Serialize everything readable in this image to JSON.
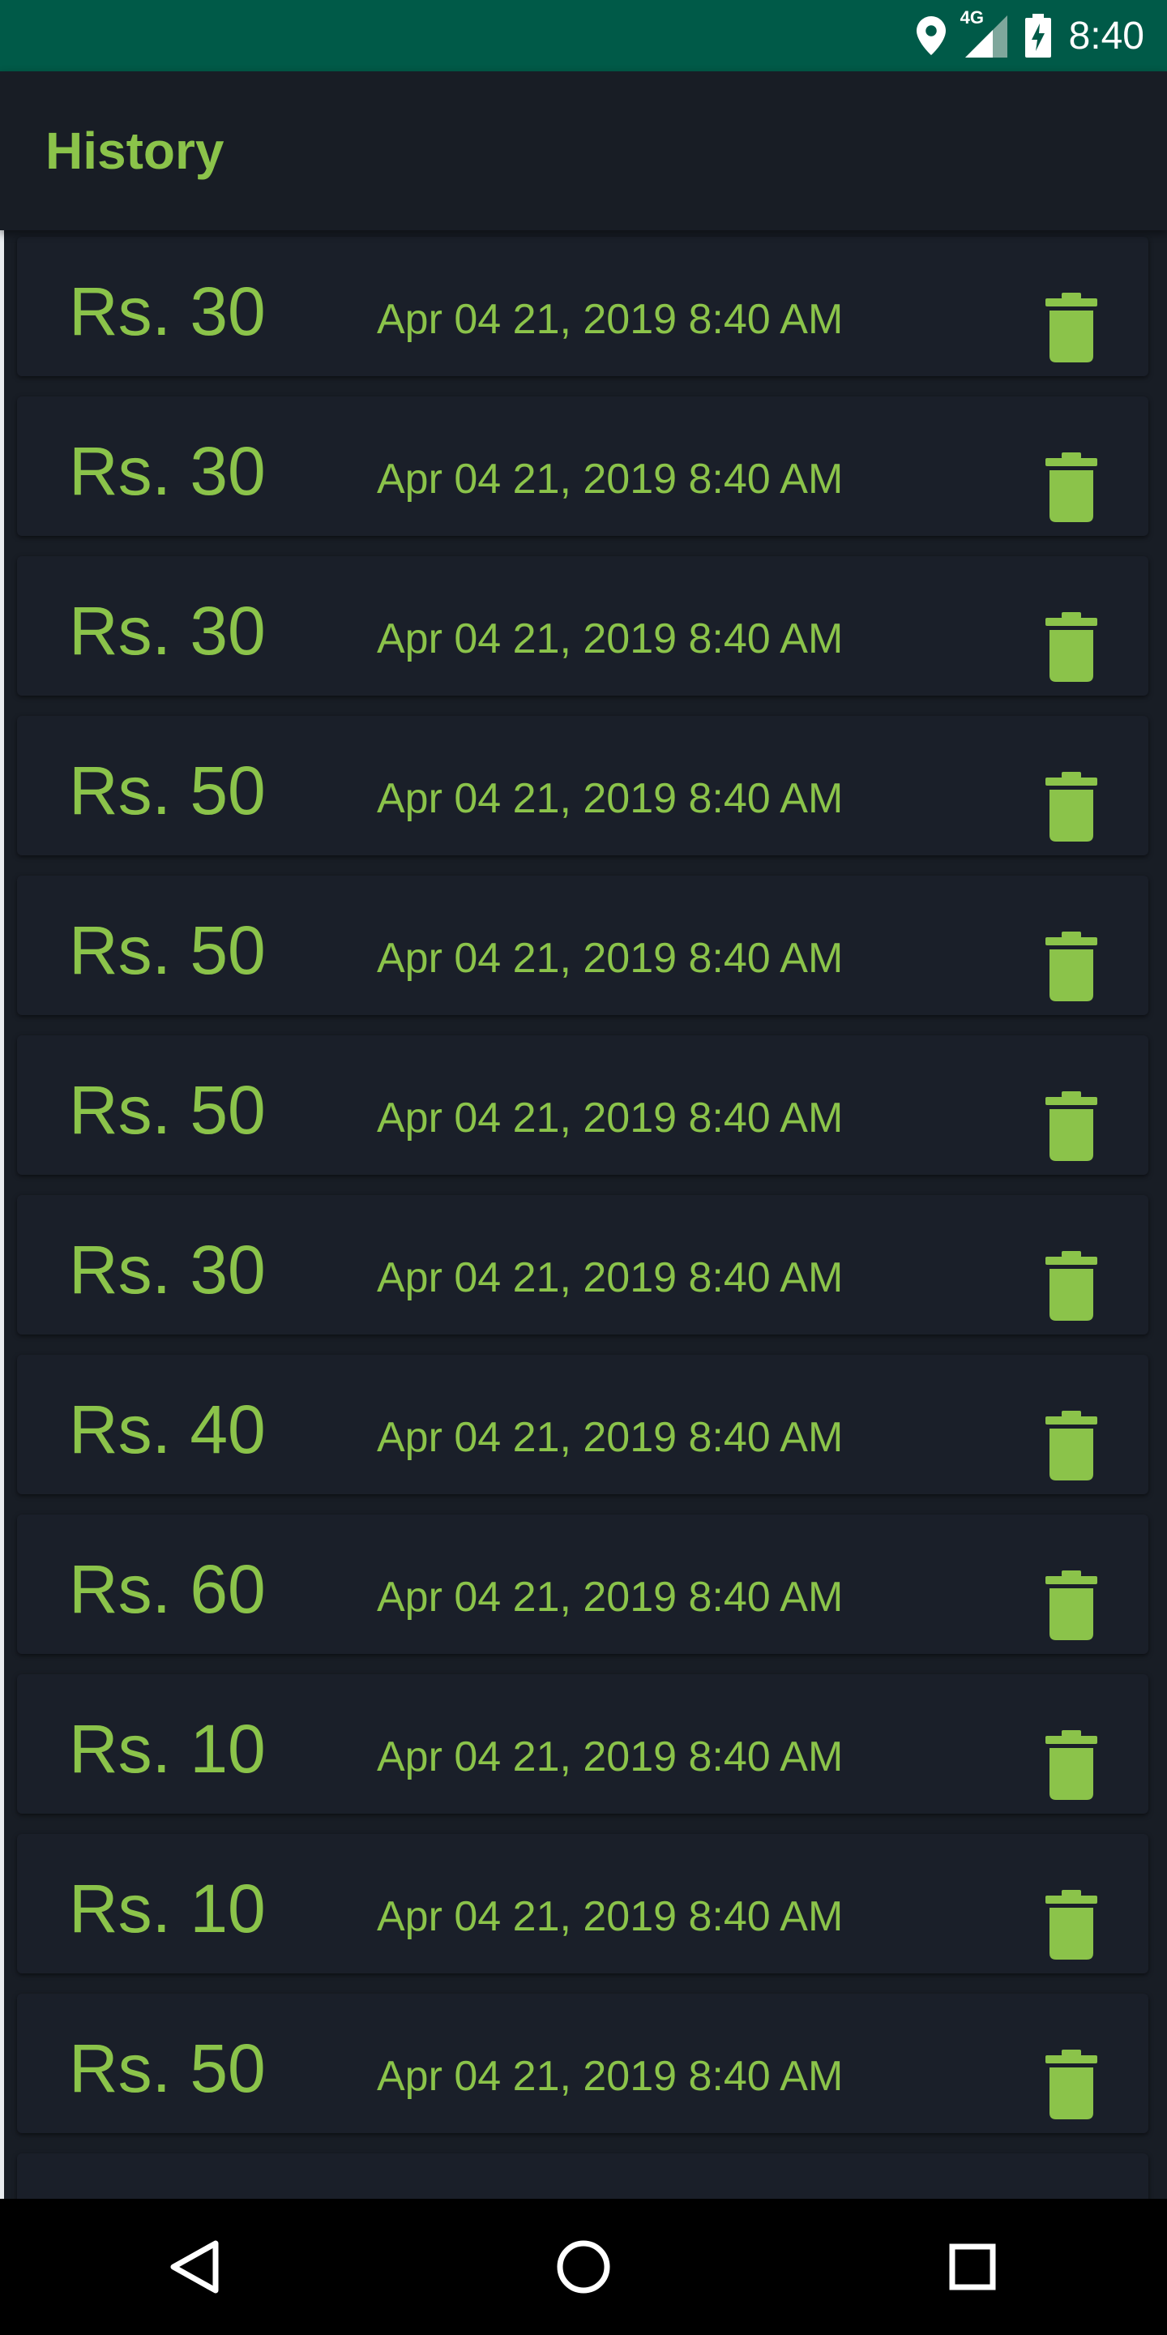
{
  "status_bar": {
    "time": "8:40",
    "network": "4G",
    "icons": [
      "location-icon",
      "signal-icon",
      "battery-charging-icon"
    ]
  },
  "app_bar": {
    "title": "History"
  },
  "history": [
    {
      "amount": "Rs. 30",
      "date": "Apr 04 21, 2019 8:40 AM"
    },
    {
      "amount": "Rs. 30",
      "date": "Apr 04 21, 2019 8:40 AM"
    },
    {
      "amount": "Rs. 30",
      "date": "Apr 04 21, 2019 8:40 AM"
    },
    {
      "amount": "Rs. 50",
      "date": "Apr 04 21, 2019 8:40 AM"
    },
    {
      "amount": "Rs. 50",
      "date": "Apr 04 21, 2019 8:40 AM"
    },
    {
      "amount": "Rs. 50",
      "date": "Apr 04 21, 2019 8:40 AM"
    },
    {
      "amount": "Rs. 30",
      "date": "Apr 04 21, 2019 8:40 AM"
    },
    {
      "amount": "Rs. 40",
      "date": "Apr 04 21, 2019 8:40 AM"
    },
    {
      "amount": "Rs. 60",
      "date": "Apr 04 21, 2019 8:40 AM"
    },
    {
      "amount": "Rs. 10",
      "date": "Apr 04 21, 2019 8:40 AM"
    },
    {
      "amount": "Rs. 10",
      "date": "Apr 04 21, 2019 8:40 AM"
    },
    {
      "amount": "Rs. 50",
      "date": "Apr 04 21, 2019 8:40 AM"
    }
  ],
  "row_icon": "delete-icon",
  "nav_bar": {
    "icons": [
      "back-icon",
      "home-icon",
      "recents-icon"
    ]
  },
  "colors": {
    "accent": "#8bc34a",
    "status_bar": "#005a48",
    "background": "#181d25",
    "card": "#1a1f29",
    "nav_bar": "#000000"
  }
}
